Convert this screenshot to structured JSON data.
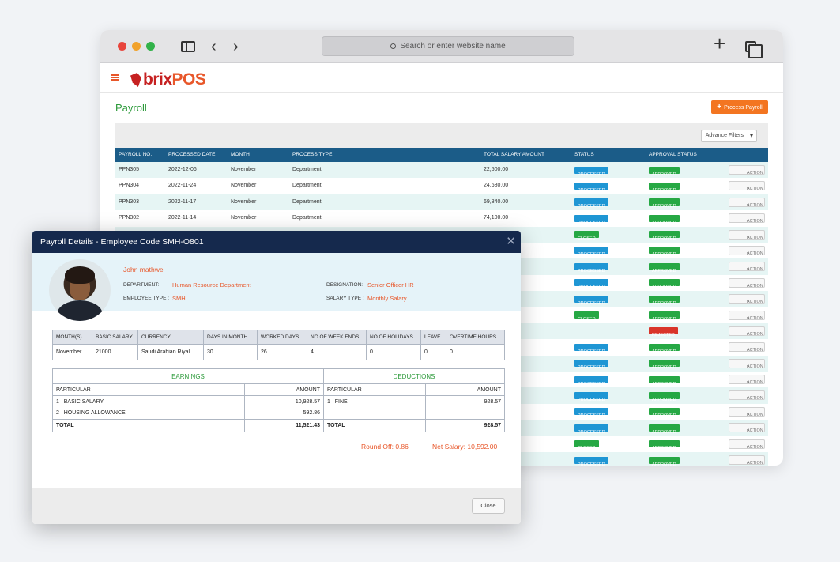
{
  "browser": {
    "url_placeholder": "Search or enter website name"
  },
  "app": {
    "logo_part1": "brix",
    "logo_part2": "POS",
    "page_title": "Payroll",
    "process_button": "Process Payroll",
    "plus_glyph": "+",
    "advance_filters": "Advance Filters"
  },
  "grid": {
    "headers": [
      "PAYROLL NO.",
      "PROCESSED DATE",
      "MONTH",
      "PROCESS TYPE",
      "TOTAL SALARY AMOUNT",
      "STATUS",
      "APPROVAL STATUS"
    ],
    "action_label": "ACTION",
    "rows": [
      {
        "no": "PPN305",
        "date": "2022-12-06",
        "month": "November",
        "type": "Department",
        "amount": "22,500.00",
        "status": "PROCESSED",
        "approval": "APPROVED"
      },
      {
        "no": "PPN304",
        "date": "2022-11-24",
        "month": "November",
        "type": "Department",
        "amount": "24,680.00",
        "status": "PROCESSED",
        "approval": "APPROVED"
      },
      {
        "no": "PPN303",
        "date": "2022-11-17",
        "month": "November",
        "type": "Department",
        "amount": "69,840.00",
        "status": "PROCESSED",
        "approval": "APPROVED"
      },
      {
        "no": "PPN302",
        "date": "2022-11-14",
        "month": "November",
        "type": "Department",
        "amount": "74,100.00",
        "status": "PROCESSED",
        "approval": "APPROVED"
      },
      {
        "status": "CLOSED",
        "approval": "APPROVED"
      },
      {
        "status": "PROCESSED",
        "approval": "APPROVED"
      },
      {
        "status": "PROCESSED",
        "approval": "APPROVED"
      },
      {
        "status": "PROCESSED",
        "approval": "APPROVED"
      },
      {
        "status": "PROCESSED",
        "approval": "APPROVED"
      },
      {
        "status": "CLOSED",
        "approval": "APPROVED"
      },
      {
        "status": "",
        "approval": "REJECTED"
      },
      {
        "status": "PROCESSED",
        "approval": "APPROVED"
      },
      {
        "status": "PROCESSED",
        "approval": "APPROVED"
      },
      {
        "status": "PROCESSED",
        "approval": "APPROVED"
      },
      {
        "status": "PROCESSED",
        "approval": "APPROVED"
      },
      {
        "status": "PROCESSED",
        "approval": "APPROVED"
      },
      {
        "status": "PROCESSED",
        "approval": "APPROVED"
      },
      {
        "status": "CLOSED",
        "approval": "APPROVED"
      },
      {
        "status": "PROCESSED",
        "approval": "APPROVED"
      }
    ]
  },
  "modal": {
    "title": "Payroll Details - Employee Code SMH-O801",
    "close_glyph": "✕",
    "employee": {
      "name": "John mathwe",
      "department_label": "DEPARTMENT:",
      "department": "Human Resource Department",
      "employee_type_label": "EMPLOYEE TYPE :",
      "employee_type": "SMH",
      "designation_label": "DESIGNATION:",
      "designation": "Senior Officer HR",
      "salary_type_label": "SALARY TYPE :",
      "salary_type": "Monthly Salary"
    },
    "month_table": {
      "headers": [
        "MONTH(S)",
        "BASIC SALARY",
        "CURRENCY",
        "DAYS IN MONTH",
        "WORKED DAYS",
        "NO OF WEEK ENDS",
        "NO OF HOLIDAYS",
        "LEAVE",
        "OVERTIME HOURS"
      ],
      "values": [
        "November",
        "21000",
        "Saudi Arabian Riyal",
        "30",
        "26",
        "4",
        "0",
        "0",
        "0"
      ]
    },
    "earnings": {
      "title": "EARNINGS",
      "particular_label": "PARTICULAR",
      "amount_label": "AMOUNT",
      "items": [
        {
          "idx": "1",
          "name": "BASIC SALARY",
          "amount": "10,928.57"
        },
        {
          "idx": "2",
          "name": "HOUSING ALLOWANCE",
          "amount": "592.86"
        }
      ],
      "total_label": "TOTAL",
      "total": "11,521.43"
    },
    "deductions": {
      "title": "DEDUCTIONS",
      "particular_label": "PARTICULAR",
      "amount_label": "AMOUNT",
      "items": [
        {
          "idx": "1",
          "name": "FINE",
          "amount": "928.57"
        }
      ],
      "total_label": "TOTAL",
      "total": "928.57"
    },
    "round_off": "Round Off: 0.86",
    "net_salary": "Net Salary: 10,592.00",
    "close_button": "Close"
  }
}
